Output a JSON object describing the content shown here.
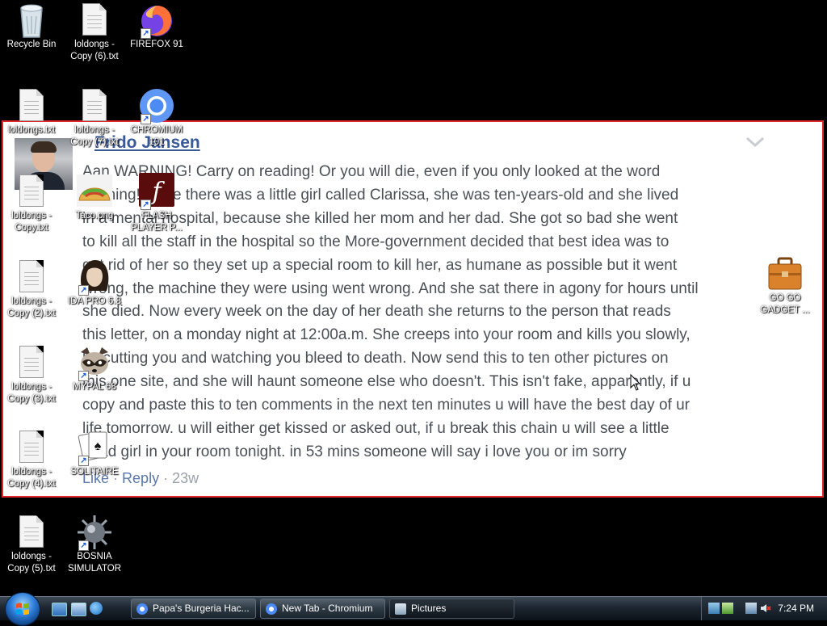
{
  "wallpaper": {
    "author": "Frido Jansen",
    "comment_lines": [
      "Aan WARNING! Carry on reading! Or you will die, even if you only looked at the word",
      "warning! Once there was a little girl called Clarissa, she was ten-years-old and she lived",
      "in a mental hospital, because she killed her mom and her dad. She got so bad she went",
      "to kill all the staff in the hospital so the More-government decided that best idea was to",
      "get rid of her so they set up a special room to kill her, as humane as possible but it went",
      "wrong, the machine they were using went wrong. And she sat there in agony for hours until",
      "she died. Now every week on the day of her death she returns to the person that reads",
      "this letter, on a monday night at 12:00a.m. She creeps into your room and kills you slowly,",
      "by cutting you and watching you bleed to death. Now send this to ten other pictures on",
      "this one site, and she will haunt someone else who doesn't. This isn't fake, apparently, if u",
      "copy and paste this to ten comments in the next ten minutes u will have the best day of ur",
      "life tomorrow. u will either get kissed or asked out, if u break this chain u will see a little",
      "dead girl in your room tonight. in 53 mins someone will say i love you or im sorry"
    ],
    "like_label": "Like",
    "reply_label": "Reply",
    "separator": "·",
    "age": "23w",
    "border_color": "#e0262a"
  },
  "desktop_icons": {
    "recycle_bin": "Recycle Bin",
    "loldongs_copy6": "loldongs - Copy (6).txt",
    "firefox": "FIREFOX 91",
    "loldongs": "loldongs.txt",
    "loldongs_copy7": "loldongs - Copy (7).txt",
    "chromium": "CHROMIUM 101",
    "loldongs_copy": "loldongs - Copy.txt",
    "taco": "Taco.png",
    "flash": "FLASH PLAYER P...",
    "loldongs_copy2": "loldongs - Copy (2).txt",
    "idapro": "IDA PRO 6.8",
    "loldongs_copy3": "loldongs - Copy (3).txt",
    "mypal": "MYPAL 68",
    "loldongs_copy4": "loldongs - Copy (4).txt",
    "solitaire": "SOLITAIRE",
    "loldongs_copy5": "loldongs - Copy (5).txt",
    "bosnia": "BOSNIA SIMULATOR",
    "gogogadget": "GO GO GADGET ..."
  },
  "taskbar": {
    "tasks": [
      "Papa's Burgeria Hac...",
      "New Tab - Chromium",
      "Pictures"
    ],
    "clock": "7:24 PM"
  }
}
